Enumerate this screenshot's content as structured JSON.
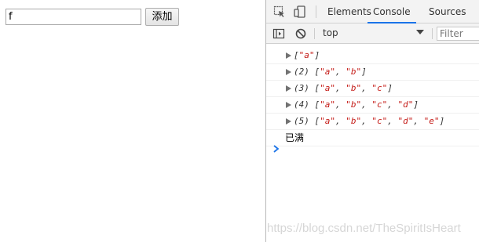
{
  "page": {
    "input_value": "f",
    "add_button_label": "添加"
  },
  "devtools": {
    "tabs": [
      {
        "label": "Elements",
        "active": false
      },
      {
        "label": "Console",
        "active": true
      },
      {
        "label": "Sources",
        "active": false
      }
    ],
    "toolbar": {
      "context": "top",
      "filter_placeholder": "Filter"
    },
    "icons": {
      "inspect": "inspect-element-icon",
      "device": "device-toolbar-icon",
      "sidebar": "console-sidebar-icon",
      "clear": "clear-console-icon",
      "expand": "expand-triangle-icon",
      "prompt": "console-prompt-icon"
    },
    "colors": {
      "active_tab": "#1a73e8",
      "string": "#c41a16",
      "prompt": "#1a73e8"
    }
  },
  "console": {
    "logs": [
      {
        "prefix": "",
        "items": [
          "\"a\""
        ]
      },
      {
        "prefix": "(2) ",
        "items": [
          "\"a\"",
          "\"b\""
        ]
      },
      {
        "prefix": "(3) ",
        "items": [
          "\"a\"",
          "\"b\"",
          "\"c\""
        ]
      },
      {
        "prefix": "(4) ",
        "items": [
          "\"a\"",
          "\"b\"",
          "\"c\"",
          "\"d\""
        ]
      },
      {
        "prefix": "(5) ",
        "items": [
          "\"a\"",
          "\"b\"",
          "\"c\"",
          "\"d\"",
          "\"e\""
        ]
      }
    ],
    "message": "已满"
  },
  "watermark": "https://blog.csdn.net/TheSpiritIsHeart"
}
